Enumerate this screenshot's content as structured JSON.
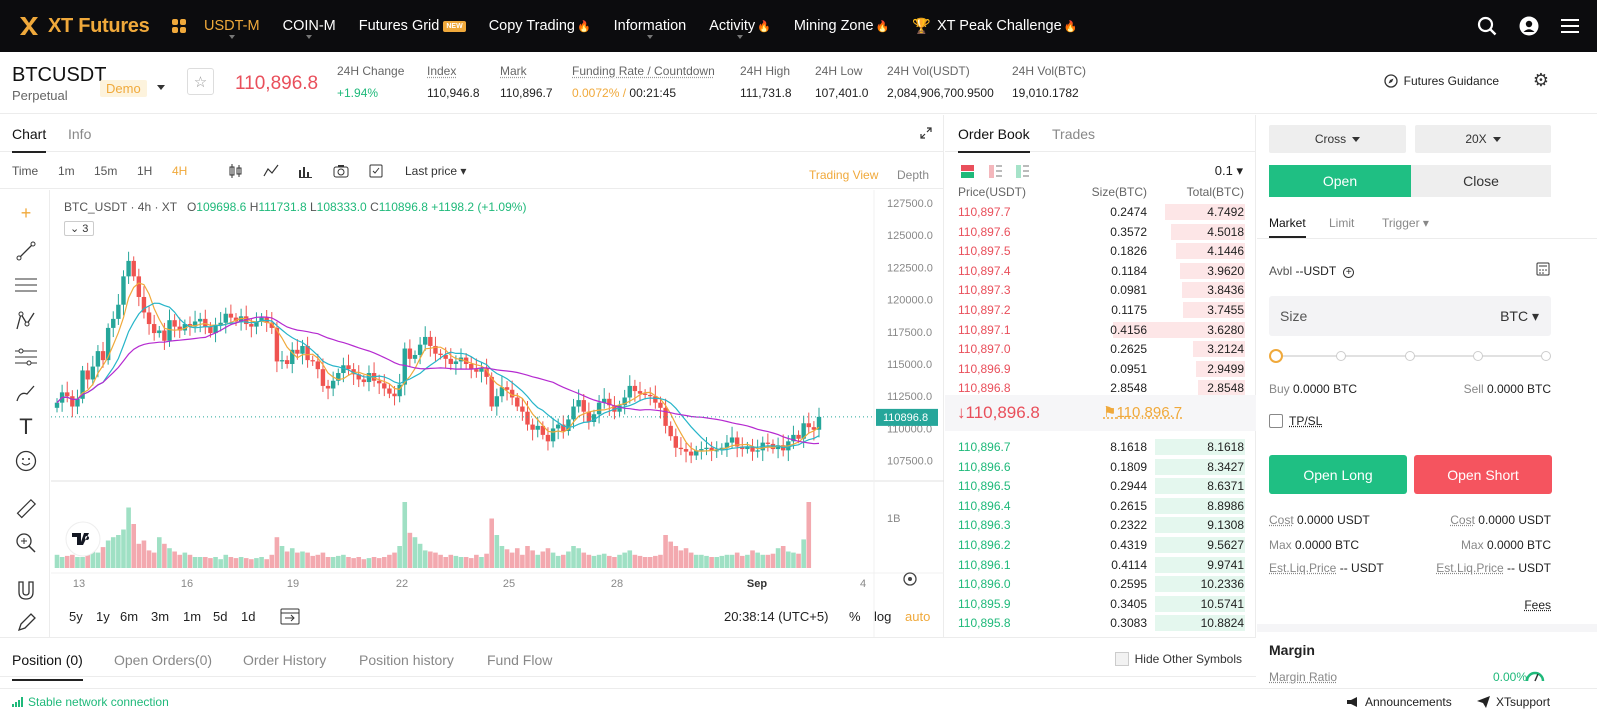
{
  "nav": {
    "brand": "XT Futures",
    "items": [
      {
        "label": "USDT-M",
        "active": true,
        "caret": true
      },
      {
        "label": "COIN-M",
        "caret": true
      },
      {
        "label": "Futures Grid",
        "badge": "NEW"
      },
      {
        "label": "Copy Trading",
        "flame": true
      },
      {
        "label": "Information",
        "caret": true
      },
      {
        "label": "Activity",
        "flame": true,
        "caret": true
      },
      {
        "label": "Mining Zone",
        "flame": true
      },
      {
        "label": "XT Peak Challenge",
        "flame": true,
        "trophy": true
      }
    ]
  },
  "ticker": {
    "symbol": "BTCUSDT",
    "type": "Perpetual",
    "mode": "Demo",
    "last_price": "110,896.8",
    "stats": [
      {
        "label": "24H Change",
        "value": "+1.94%"
      },
      {
        "label": "Index",
        "value": "110,946.8"
      },
      {
        "label": "Mark",
        "value": "110,896.7"
      },
      {
        "label": "Funding Rate / Countdown",
        "value_a": "0.0072%",
        "value_sep": " / ",
        "value_b": "00:21:45"
      },
      {
        "label": "24H High",
        "value": "111,731.8"
      },
      {
        "label": "24H Low",
        "value": "107,401.0"
      },
      {
        "label": "24H Vol(USDT)",
        "value": "2,084,906,700.9500"
      },
      {
        "label": "24H Vol(BTC)",
        "value": "19,010.1782"
      }
    ],
    "guidance": "Futures Guidance"
  },
  "chart_tabs": [
    "Chart",
    "Info"
  ],
  "chart_toolbar": {
    "time_label": "Time",
    "timeframes": [
      "1m",
      "15m",
      "1H",
      "4H"
    ],
    "selected": "4H",
    "price_type": "Last price",
    "views": [
      "Trading View",
      "Depth"
    ]
  },
  "chart_data": {
    "type": "candlestick",
    "title": "BTC_USDT · 4h · XT",
    "ohlc": {
      "o": "109698.6",
      "h": "111731.8",
      "l": "108333.0",
      "c": "110896.8",
      "change": "+1198.2 (+1.09%)"
    },
    "indicator_count": "3",
    "y_ticks": [
      127500.0,
      125000.0,
      122500.0,
      120000.0,
      117500.0,
      115000.0,
      112500.0,
      110000.0,
      107500.0
    ],
    "ylim": [
      106000,
      128500
    ],
    "current_price": 110896.8,
    "current_price_label": "110896.8",
    "x_ticks": [
      "13",
      "16",
      "19",
      "22",
      "25",
      "28",
      "Sep",
      "4"
    ],
    "volume_tick": "1B",
    "closes": [
      112000,
      112800,
      112500,
      111700,
      112300,
      114500,
      113800,
      114800,
      116000,
      115300,
      117800,
      118500,
      119600,
      121800,
      123000,
      121800,
      120200,
      119000,
      118100,
      117400,
      117600,
      116800,
      118400,
      117900,
      117600,
      118100,
      117900,
      118300,
      118500,
      117900,
      117400,
      118000,
      118200,
      118900,
      118600,
      118300,
      118700,
      118100,
      117900,
      118300,
      118600,
      118200,
      117800,
      115200,
      115300,
      115000,
      116100,
      115800,
      116400,
      115300,
      115200,
      114600,
      113300,
      113100,
      113700,
      114300,
      114900,
      114600,
      114200,
      113800,
      113600,
      114300,
      113700,
      113500,
      113100,
      112700,
      112500,
      113400,
      116200,
      115400,
      115700,
      116500,
      117100,
      116400,
      115800,
      115700,
      115400,
      115000,
      115200,
      115500,
      115000,
      114600,
      114400,
      114700,
      114000,
      111700,
      112500,
      113200,
      113000,
      112400,
      111700,
      111300,
      110300,
      109900,
      110200,
      109500,
      109000,
      110000,
      110300,
      109800,
      110700,
      111700,
      112200,
      111300,
      110500,
      111100,
      112000,
      112300,
      111800,
      111300,
      111800,
      112400,
      113300,
      112900,
      112700,
      112600,
      112500,
      112000,
      111600,
      110200,
      109400,
      108500,
      108400,
      108200,
      107900,
      108300,
      108400,
      108500,
      108300,
      108300,
      108500,
      108900,
      109300,
      108600,
      108400,
      108600,
      108200,
      108300,
      108900,
      108800,
      108400,
      108700,
      108300,
      109000,
      109500,
      109200,
      110400,
      110100,
      109900,
      110896.8
    ],
    "volumes": [
      0.12,
      0.1,
      0.11,
      0.12,
      0.1,
      0.1,
      0.15,
      0.18,
      0.14,
      0.19,
      0.25,
      0.28,
      0.3,
      0.35,
      0.55,
      0.4,
      0.22,
      0.25,
      0.16,
      0.14,
      0.28,
      0.22,
      0.18,
      0.15,
      0.12,
      0.14,
      0.12,
      0.1,
      0.1,
      0.1,
      0.09,
      0.1,
      0.08,
      0.12,
      0.1,
      0.09,
      0.1,
      0.09,
      0.08,
      0.09,
      0.1,
      0.08,
      0.12,
      0.28,
      0.2,
      0.15,
      0.18,
      0.14,
      0.15,
      0.14,
      0.11,
      0.12,
      0.14,
      0.1,
      0.1,
      0.11,
      0.12,
      0.1,
      0.09,
      0.1,
      0.08,
      0.09,
      0.1,
      0.09,
      0.1,
      0.12,
      0.14,
      0.2,
      0.6,
      0.32,
      0.28,
      0.22,
      0.16,
      0.15,
      0.14,
      0.12,
      0.1,
      0.12,
      0.11,
      0.1,
      0.1,
      0.09,
      0.12,
      0.1,
      0.13,
      0.45,
      0.3,
      0.2,
      0.17,
      0.14,
      0.18,
      0.12,
      0.2,
      0.16,
      0.12,
      0.15,
      0.18,
      0.14,
      0.11,
      0.12,
      0.15,
      0.2,
      0.18,
      0.14,
      0.12,
      0.11,
      0.12,
      0.13,
      0.11,
      0.1,
      0.12,
      0.14,
      0.16,
      0.12,
      0.11,
      0.1,
      0.1,
      0.11,
      0.12,
      0.3,
      0.24,
      0.2,
      0.16,
      0.18,
      0.14,
      0.12,
      0.12,
      0.11,
      0.1,
      0.1,
      0.11,
      0.12,
      0.12,
      0.14,
      0.11,
      0.12,
      0.16,
      0.14,
      0.12,
      0.12,
      0.13,
      0.18,
      0.2,
      0.15,
      0.14,
      0.13,
      0.26,
      0.6
    ]
  },
  "chart_bottom": {
    "ranges": [
      "5y",
      "1y",
      "6m",
      "3m",
      "1m",
      "5d",
      "1d"
    ],
    "time": "20:38:14 (UTC+5)",
    "percent": "%",
    "log": "log",
    "auto": "auto"
  },
  "order_book": {
    "tabs": [
      "Order Book",
      "Trades"
    ],
    "precision": "0.1",
    "headers": [
      "Price(USDT)",
      "Size(BTC)",
      "Total(BTC)"
    ],
    "asks": [
      [
        "110,897.7",
        "0.2474",
        "4.7492",
        0.44
      ],
      [
        "110,897.6",
        "0.3572",
        "4.5018",
        0.41
      ],
      [
        "110,897.5",
        "0.1826",
        "4.1446",
        0.38
      ],
      [
        "110,897.4",
        "0.1184",
        "3.9620",
        0.36
      ],
      [
        "110,897.3",
        "0.0981",
        "3.8436",
        0.35
      ],
      [
        "110,897.2",
        "0.1175",
        "3.7455",
        0.34
      ],
      [
        "110,897.1",
        "0.4156",
        "3.6280",
        0.73
      ],
      [
        "110,897.0",
        "0.2625",
        "3.2124",
        0.29
      ],
      [
        "110,896.9",
        "0.0951",
        "2.9499",
        0.27
      ],
      [
        "110,896.8",
        "2.8548",
        "2.8548",
        0.26
      ]
    ],
    "mid_price": "110,896.8",
    "mark_price": "110,896.7",
    "bids": [
      [
        "110,896.7",
        "8.1618",
        "8.1618",
        0.5
      ],
      [
        "110,896.6",
        "0.1809",
        "8.3427",
        0.5
      ],
      [
        "110,896.5",
        "0.2944",
        "8.6371",
        0.5
      ],
      [
        "110,896.4",
        "0.2615",
        "8.8986",
        0.5
      ],
      [
        "110,896.3",
        "0.2322",
        "9.1308",
        0.5
      ],
      [
        "110,896.2",
        "0.4319",
        "9.5627",
        0.5
      ],
      [
        "110,896.1",
        "0.4114",
        "9.9741",
        0.5
      ],
      [
        "110,896.0",
        "0.2595",
        "10.2336",
        0.5
      ],
      [
        "110,895.9",
        "0.3405",
        "10.5741",
        0.5
      ],
      [
        "110,895.8",
        "0.3083",
        "10.8824",
        0.5
      ]
    ]
  },
  "order_panel": {
    "margin_mode": "Cross",
    "leverage": "20X",
    "open": "Open",
    "close": "Close",
    "types": [
      "Market",
      "Limit",
      "Trigger"
    ],
    "avbl_label": "Avbl",
    "avbl_value": "--USDT",
    "size_placeholder": "Size",
    "size_unit": "BTC",
    "slider_level": 0,
    "buy_label": "Buy",
    "buy_value": "0.0000 BTC",
    "sell_label": "Sell",
    "sell_value": "0.0000 BTC",
    "tpsl": "TP/SL",
    "open_long": "Open Long",
    "open_short": "Open Short",
    "cost_label": "Cost",
    "cost_long": "0.0000 USDT",
    "cost_short": "0.0000 USDT",
    "max_label": "Max",
    "max_long": "0.0000 BTC",
    "max_short": "0.0000 BTC",
    "liq_label": "Est.Liq.Price",
    "liq_long": "-- USDT",
    "liq_short": "-- USDT",
    "fees": "Fees",
    "margin_title": "Margin",
    "margin_ratio_label": "Margin Ratio",
    "margin_ratio_value": "0.00%"
  },
  "bottom_tabs": [
    "Position (0)",
    "Open Orders(0)",
    "Order History",
    "Position history",
    "Fund Flow"
  ],
  "hide_other": "Hide Other Symbols",
  "footer": {
    "status": "Stable network connection",
    "announcements": "Announcements",
    "support": "XTsupport"
  },
  "colors": {
    "accent": "#f0a93b",
    "up": "#1fb97a",
    "down": "#e94f5b",
    "nav_bg": "#0c0c0e"
  }
}
